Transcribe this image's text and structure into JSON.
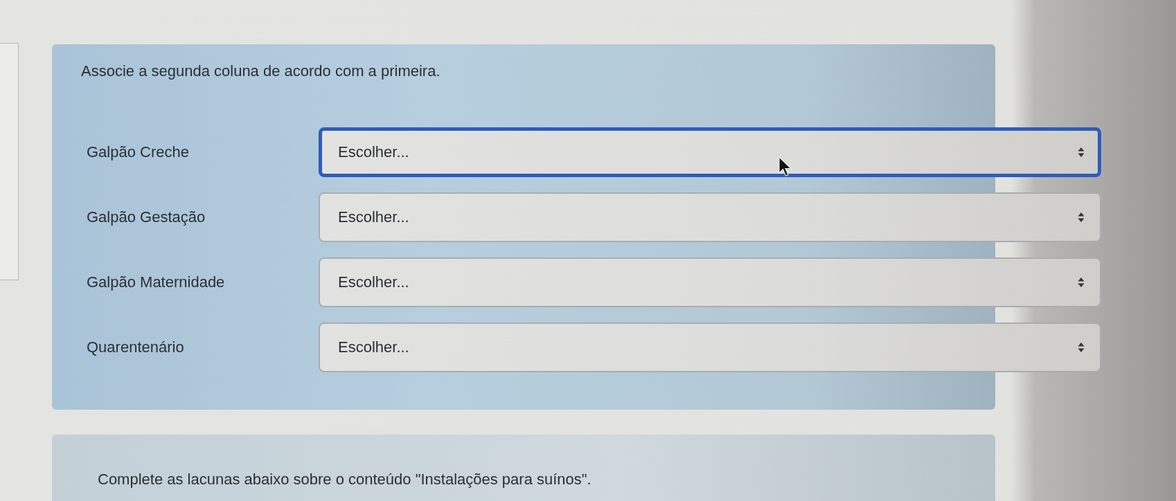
{
  "question_1": {
    "instruction": "Associe a segunda coluna de acordo com a primeira.",
    "items": [
      {
        "label": "Galpão Creche",
        "choice": "Escolher...",
        "focused": true
      },
      {
        "label": "Galpão Gestação",
        "choice": "Escolher...",
        "focused": false
      },
      {
        "label": "Galpão Maternidade",
        "choice": "Escolher...",
        "focused": false
      },
      {
        "label": "Quarentenário",
        "choice": "Escolher...",
        "focused": false
      }
    ]
  },
  "question_2": {
    "instruction": "Complete as lacunas abaixo sobre o conteúdo \"Instalações para suínos\"."
  }
}
